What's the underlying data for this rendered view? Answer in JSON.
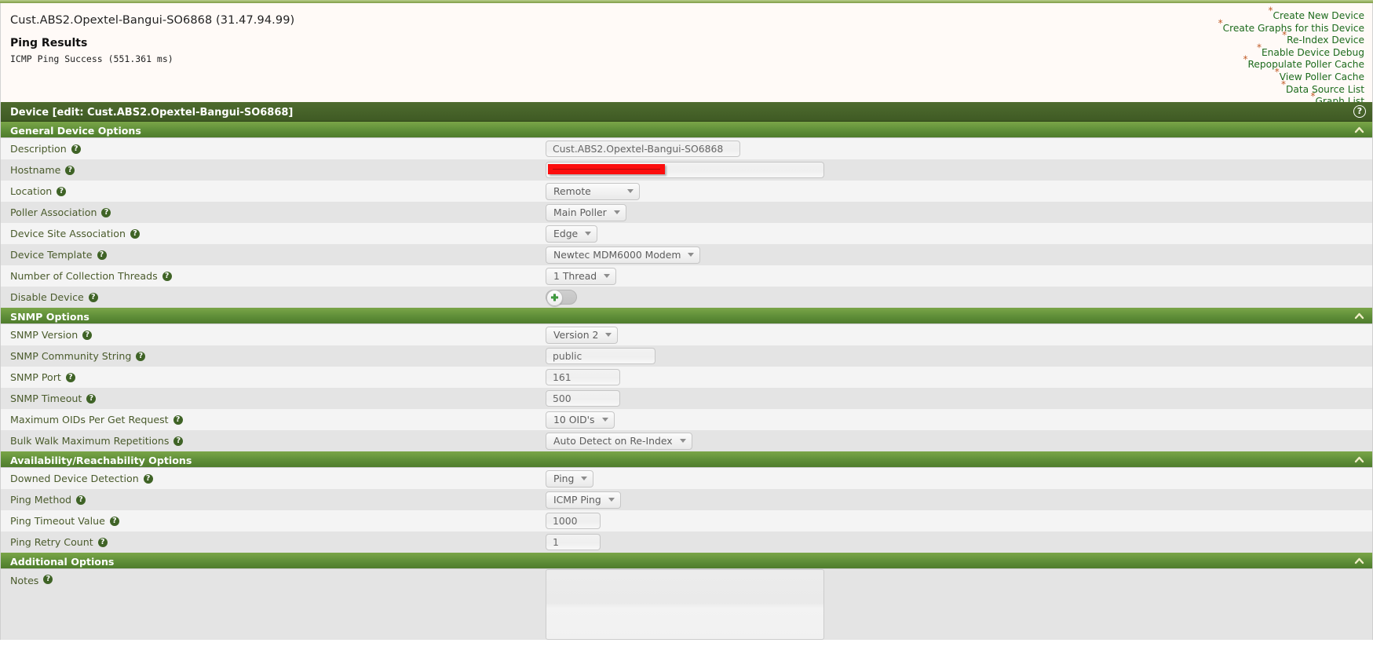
{
  "header": {
    "device_title": "Cust.ABS2.Opextel-Bangui-SO6868 (31.47.94.99)",
    "ping_heading": "Ping Results",
    "ping_result": "ICMP Ping Success (551.361 ms)"
  },
  "actions": [
    {
      "label": "Create New Device"
    },
    {
      "label": "Create Graphs for this Device"
    },
    {
      "label": "Re-Index Device"
    },
    {
      "label": "Enable Device Debug"
    },
    {
      "label": "Repopulate Poller Cache"
    },
    {
      "label": "View Poller Cache"
    },
    {
      "label": "Data Source List"
    },
    {
      "label": "Graph List"
    }
  ],
  "panel": {
    "title": "Device [edit: Cust.ABS2.Opextel-Bangui-SO6868]",
    "help_glyph": "?"
  },
  "sections": {
    "general": {
      "title": "General Device Options"
    },
    "snmp": {
      "title": "SNMP Options"
    },
    "availability": {
      "title": "Availability/Reachability Options"
    },
    "additional": {
      "title": "Additional Options"
    }
  },
  "fields": {
    "description": {
      "label": "Description",
      "value": "Cust.ABS2.Opextel-Bangui-SO6868"
    },
    "hostname": {
      "label": "Hostname",
      "value": ""
    },
    "location": {
      "label": "Location",
      "value": "Remote"
    },
    "poller_association": {
      "label": "Poller Association",
      "value": "Main Poller"
    },
    "device_site_association": {
      "label": "Device Site Association",
      "value": "Edge"
    },
    "device_template": {
      "label": "Device Template",
      "value": "Newtec MDM6000 Modem"
    },
    "collection_threads": {
      "label": "Number of Collection Threads",
      "value": "1 Thread"
    },
    "disable_device": {
      "label": "Disable Device",
      "value": "off"
    },
    "snmp_version": {
      "label": "SNMP Version",
      "value": "Version 2"
    },
    "snmp_community": {
      "label": "SNMP Community String",
      "value": "public"
    },
    "snmp_port": {
      "label": "SNMP Port",
      "value": "161"
    },
    "snmp_timeout": {
      "label": "SNMP Timeout",
      "value": "500"
    },
    "max_oids": {
      "label": "Maximum OIDs Per Get Request",
      "value": "10 OID's"
    },
    "bulk_walk": {
      "label": "Bulk Walk Maximum Repetitions",
      "value": "Auto Detect on Re-Index"
    },
    "downed_detection": {
      "label": "Downed Device Detection",
      "value": "Ping"
    },
    "ping_method": {
      "label": "Ping Method",
      "value": "ICMP Ping"
    },
    "ping_timeout": {
      "label": "Ping Timeout Value",
      "value": "1000"
    },
    "ping_retry": {
      "label": "Ping Retry Count",
      "value": "1"
    },
    "notes": {
      "label": "Notes",
      "value": ""
    }
  },
  "icons": {
    "help": "?",
    "collapse": "chevron-up-icon",
    "star": "*"
  },
  "colors": {
    "panel_title_bg": "#3f5a24",
    "section_bg": "#62913a",
    "link": "#1d6b1d",
    "star": "#c05a26",
    "label": "#4a5b2c",
    "redaction": "#fc0d0d",
    "row_odd": "#f4f4f4",
    "row_even": "#e4e4e4"
  }
}
